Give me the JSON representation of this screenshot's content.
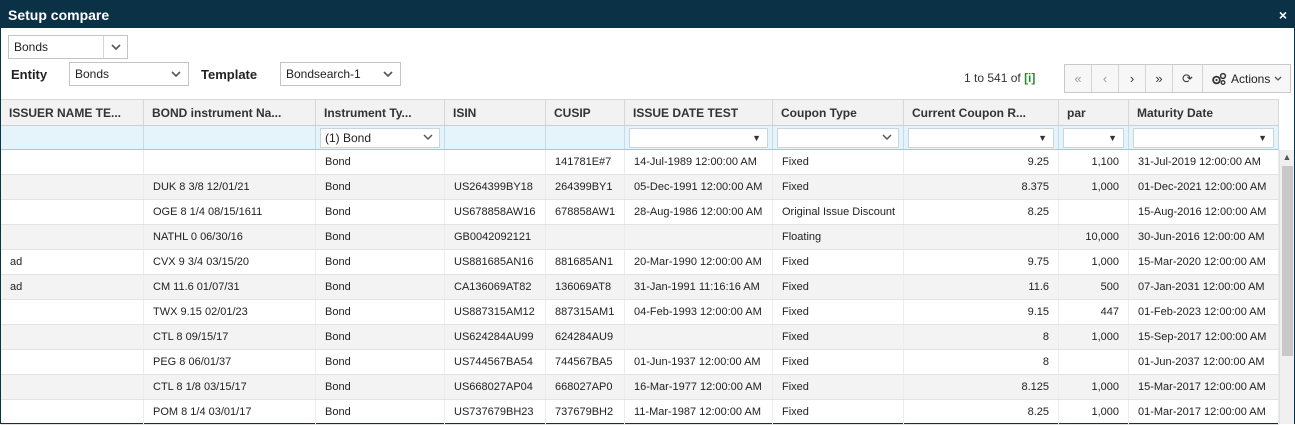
{
  "window": {
    "title": "Setup compare",
    "close_glyph": "×"
  },
  "top_select": {
    "value": "Bonds"
  },
  "entity": {
    "label": "Entity",
    "value": "Bonds"
  },
  "template": {
    "label": "Template",
    "value": "Bondsearch-1"
  },
  "pager": {
    "text": "1 to 541 of",
    "info_glyph": "[i]"
  },
  "toolbar": {
    "first": "«",
    "prev": "‹",
    "next": "›",
    "last": "»",
    "refresh": "⟳",
    "actions_label": "Actions",
    "actions_icon": "gears-icon"
  },
  "columns": [
    "ISSUER NAME TE...",
    "BOND instrument Na...",
    "Instrument Ty...",
    "ISIN",
    "CUSIP",
    "ISSUE DATE TEST",
    "Coupon Type",
    "Current Coupon R...",
    "par",
    "Maturity Date"
  ],
  "filters": {
    "instrument_type": "(1) Bond"
  },
  "rows": [
    [
      "",
      "",
      "Bond",
      "",
      "141781E#7",
      "14-Jul-1989 12:00:00 AM",
      "Fixed",
      "9.25",
      "1,100",
      "31-Jul-2019 12:00:00 AM"
    ],
    [
      "",
      "DUK 8 3/8 12/01/21",
      "Bond",
      "US264399BY18",
      "264399BY1",
      "05-Dec-1991 12:00:00 AM",
      "Fixed",
      "8.375",
      "1,000",
      "01-Dec-2021 12:00:00 AM"
    ],
    [
      "",
      "OGE 8 1/4 08/15/1611",
      "Bond",
      "US678858AW16",
      "678858AW1",
      "28-Aug-1986 12:00:00 AM",
      "Original Issue Discount",
      "8.25",
      "",
      "15-Aug-2016 12:00:00 AM"
    ],
    [
      "",
      "NATHL 0 06/30/16",
      "Bond",
      "GB0042092121",
      "",
      "",
      "Floating",
      "",
      "10,000",
      "30-Jun-2016 12:00:00 AM"
    ],
    [
      "ad",
      "CVX 9 3/4 03/15/20",
      "Bond",
      "US881685AN16",
      "881685AN1",
      "20-Mar-1990 12:00:00 AM",
      "Fixed",
      "9.75",
      "1,000",
      "15-Mar-2020 12:00:00 AM"
    ],
    [
      "ad",
      "CM 11.6 01/07/31",
      "Bond",
      "CA136069AT82",
      "136069AT8",
      "31-Jan-1991 11:16:16 AM",
      "Fixed",
      "11.6",
      "500",
      "07-Jan-2031 12:00:00 AM"
    ],
    [
      "",
      "TWX 9.15 02/01/23",
      "Bond",
      "US887315AM12",
      "887315AM1",
      "04-Feb-1993 12:00:00 AM",
      "Fixed",
      "9.15",
      "447",
      "01-Feb-2023 12:00:00 AM"
    ],
    [
      "",
      "CTL 8 09/15/17",
      "Bond",
      "US624284AU99",
      "624284AU9",
      "",
      "Fixed",
      "8",
      "1,000",
      "15-Sep-2017 12:00:00 AM"
    ],
    [
      "",
      "PEG 8 06/01/37",
      "Bond",
      "US744567BA54",
      "744567BA5",
      "01-Jun-1937 12:00:00 AM",
      "Fixed",
      "8",
      "",
      "01-Jun-2037 12:00:00 AM"
    ],
    [
      "",
      "CTL 8 1/8 03/15/17",
      "Bond",
      "US668027AP04",
      "668027AP0",
      "16-Mar-1977 12:00:00 AM",
      "Fixed",
      "8.125",
      "1,000",
      "15-Mar-2017 12:00:00 AM"
    ],
    [
      "",
      "POM 8 1/4 03/01/17",
      "Bond",
      "US737679BH23",
      "737679BH2",
      "11-Mar-1987 12:00:00 AM",
      "Fixed",
      "8.25",
      "1,000",
      "01-Mar-2017 12:00:00 AM"
    ]
  ]
}
